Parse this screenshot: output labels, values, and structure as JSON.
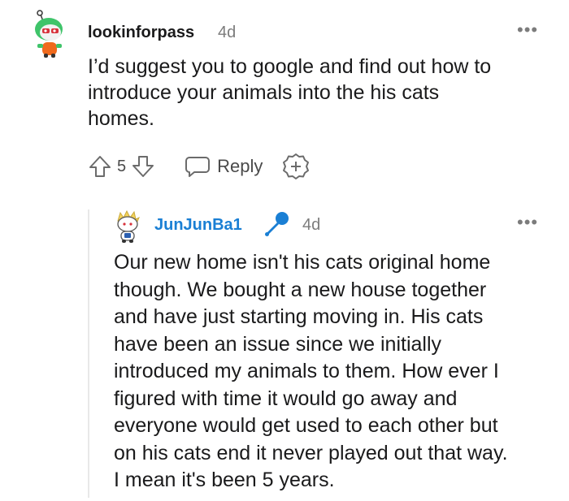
{
  "comment": {
    "username": "lookinforpass",
    "age": "4d",
    "more": "•••",
    "body_lines": [
      "I’d suggest you to google and find out how to",
      "introduce your animals into the his cats",
      "homes."
    ],
    "actions": {
      "vote_count": "5",
      "reply_label": "Reply"
    }
  },
  "reply": {
    "username": "JunJunBa1",
    "age": "4d",
    "more": "•••",
    "body_lines": [
      "Our new home isn't his cats original home",
      "though. We bought a new house together",
      "and have just starting moving in. His cats",
      "have been an issue since we initially",
      "introduced my animals to them. How ever I",
      "figured with time it would go away and",
      "everyone would get used to each other but",
      "on his cats end it never played out that way.",
      "I mean it's been 5 years."
    ]
  },
  "colors": {
    "username_op": "#1a7fd4",
    "mic": "#1a7fd4",
    "muted": "#7c7c7c"
  }
}
